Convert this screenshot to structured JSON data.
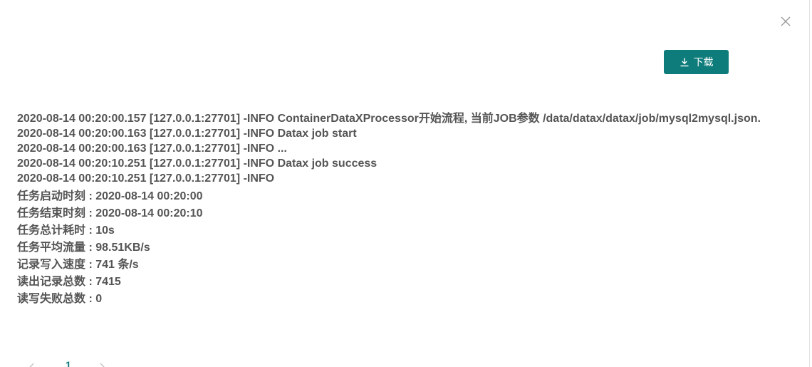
{
  "dialog": {
    "close_icon": "close-icon",
    "download": {
      "icon": "download-icon",
      "label": "下载",
      "color": "#0e7c7b"
    }
  },
  "log": {
    "lines": [
      "2020-08-14 00:20:00.157 [127.0.0.1:27701] -INFO ContainerDataXProcessor开始流程, 当前JOB参数 /data/datax/datax/job/mysql2mysql.json.",
      "2020-08-14 00:20:00.163 [127.0.0.1:27701] -INFO Datax job start",
      "2020-08-14 00:20:00.163 [127.0.0.1:27701] -INFO ...",
      "2020-08-14 00:20:10.251 [127.0.0.1:27701] -INFO Datax job success",
      "2020-08-14 00:20:10.251 [127.0.0.1:27701] -INFO"
    ],
    "stats": [
      "任务启动时刻 : 2020-08-14 00:20:00",
      "任务结束时刻 : 2020-08-14 00:20:10",
      "任务总计耗时 : 10s",
      "任务平均流量 : 98.51KB/s",
      "记录写入速度 : 741 条/s",
      "读出记录总数 : 7415",
      "读写失败总数 : 0"
    ],
    "text_color": "#555555"
  },
  "pagination": {
    "prev_icon": "chevron-left-icon",
    "current_page": "1",
    "next_icon": "chevron-right-icon"
  }
}
